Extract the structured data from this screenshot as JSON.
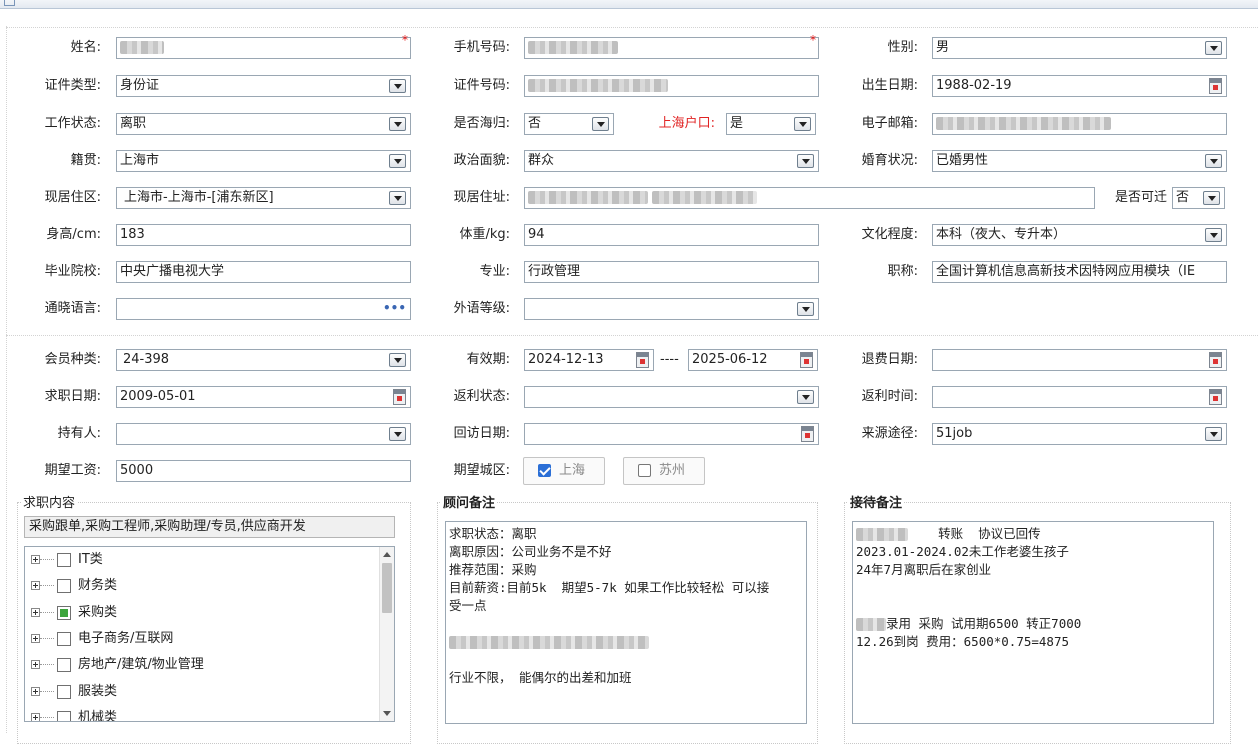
{
  "personal": {
    "name": {
      "label": "姓名:",
      "required": "*"
    },
    "phone": {
      "label": "手机号码:",
      "required": "*"
    },
    "gender": {
      "label": "性别:",
      "value": "男"
    },
    "id_type": {
      "label": "证件类型:",
      "value": "身份证"
    },
    "id_number": {
      "label": "证件号码:"
    },
    "birth_date": {
      "label": "出生日期:",
      "value": "1988-02-19"
    },
    "work_status": {
      "label": "工作状态:",
      "value": "离职"
    },
    "overseas_return": {
      "label": "是否海归:",
      "value": "否"
    },
    "shanghai_hukou": {
      "label": "上海户口:",
      "value": "是"
    },
    "email": {
      "label": "电子邮箱:"
    },
    "native_place": {
      "label": "籍贯:",
      "value": "上海市"
    },
    "political_status": {
      "label": "政治面貌:",
      "value": "群众"
    },
    "marital_status": {
      "label": "婚育状况:",
      "value": "已婚男性"
    },
    "residence_area": {
      "label": "现居住区:",
      "value": "上海市-上海市-[浦东新区]"
    },
    "address": {
      "label": "现居住址:"
    },
    "relocatable": {
      "label": "是否可迁",
      "value": "否"
    },
    "height": {
      "label": "身高/cm:",
      "value": "183"
    },
    "weight": {
      "label": "体重/kg:",
      "value": "94"
    },
    "education": {
      "label": "文化程度:",
      "value": "本科（夜大、专升本）"
    },
    "school": {
      "label": "毕业院校:",
      "value": "中央广播电视大学"
    },
    "major": {
      "label": "专业:",
      "value": "行政管理"
    },
    "title": {
      "label": "职称:",
      "value": "全国计算机信息高新技术因特网应用模块（IE"
    },
    "languages": {
      "label": "通晓语言:",
      "value": ""
    },
    "foreign_level": {
      "label": "外语等级:",
      "value": ""
    }
  },
  "membership": {
    "member_type": {
      "label": "会员种类:",
      "value": "24-398"
    },
    "valid_period": {
      "label": "有效期:",
      "from": "2024-12-13",
      "separator": "----",
      "to": "2025-06-12"
    },
    "refund_date": {
      "label": "退费日期:",
      "value": ""
    },
    "job_seek_date": {
      "label": "求职日期:",
      "value": "2009-05-01"
    },
    "rebate_status": {
      "label": "返利状态:",
      "value": ""
    },
    "rebate_time": {
      "label": "返利时间:",
      "value": ""
    },
    "holder": {
      "label": "持有人:",
      "value": ""
    },
    "followup_date": {
      "label": "回访日期:",
      "value": ""
    },
    "source": {
      "label": "来源途径:",
      "value": "51job"
    },
    "expected_salary": {
      "label": "期望工资:",
      "value": "5000"
    },
    "expected_city": {
      "label": "期望城区:",
      "options": [
        {
          "label": "上海",
          "checked": true
        },
        {
          "label": "苏州",
          "checked": false
        }
      ]
    }
  },
  "job_content": {
    "title": "求职内容",
    "summary": "采购跟单,采购工程师,采购助理/专员,供应商开发",
    "categories": [
      {
        "label": "IT类",
        "checked": "none"
      },
      {
        "label": "财务类",
        "checked": "none"
      },
      {
        "label": "采购类",
        "checked": "partial"
      },
      {
        "label": "电子商务/互联网",
        "checked": "none"
      },
      {
        "label": "房地产/建筑/物业管理",
        "checked": "none"
      },
      {
        "label": "服装类",
        "checked": "none"
      },
      {
        "label": "机械类",
        "checked": "none"
      }
    ]
  },
  "consultant_notes": {
    "title": "顾问备注",
    "lines": [
      "求职状态：离职",
      "离职原因：公司业务不是不好",
      "推荐范围：采购",
      "目前薪资:目前5k  期望5-7k 如果工作比较轻松 可以接",
      "受一点",
      "",
      "",
      "",
      "行业不限， 能偶尔的出差和加班"
    ]
  },
  "reception_notes": {
    "title": "接待备注",
    "line1_suffix": "转账  协议已回传",
    "lines": [
      "2023.01-2024.02未工作老婆生孩子",
      "24年7月离职后在家创业",
      "",
      ""
    ],
    "line_hire_suffix": "录用 采购 试用期6500 转正7000",
    "line_last": "12.26到岗 费用：6500*0.75=4875"
  }
}
